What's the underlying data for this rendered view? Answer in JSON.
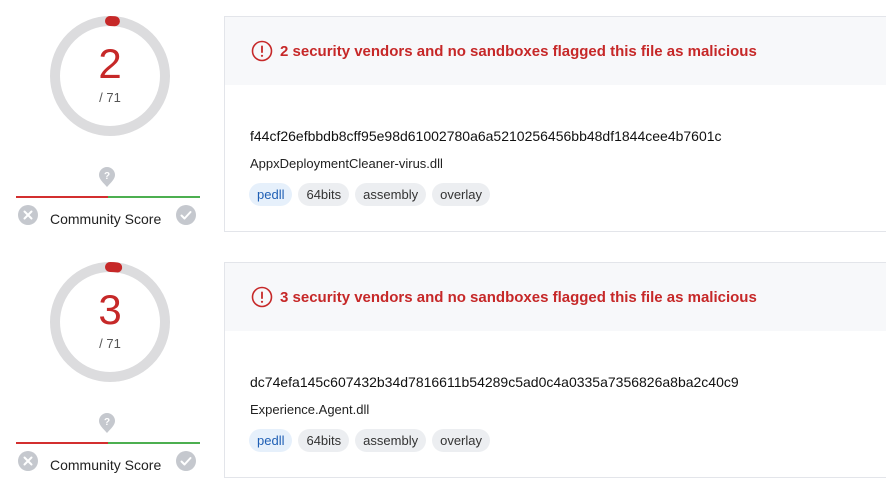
{
  "colors": {
    "alert": "#c62828",
    "gauge_track": "#dcdcde",
    "gauge_fill": "#c62828",
    "gauge_inner": "#ffffff",
    "score_negative": "#d32f2f",
    "score_positive": "#4caf50",
    "icon_gray": "#c5c8ce",
    "tag_primary_bg": "#e6f0fb",
    "tag_bg": "#eceef1"
  },
  "results": [
    {
      "detections": "2",
      "total": "/ 71",
      "detection_ratio": 0.028,
      "community_score_label": "Community Score",
      "alert": "2 security vendors and no sandboxes flagged this file as malicious",
      "hash": "f44cf26efbbdb8cff95e98d61002780a6a5210256456bb48df1844cee4b7601c",
      "filename": "AppxDeploymentCleaner-virus.dll",
      "tags": [
        "pedll",
        "64bits",
        "assembly",
        "overlay"
      ],
      "icons": {
        "unknown": "question-mark-icon",
        "negative": "x-icon",
        "positive": "check-icon",
        "alert": "exclamation-circle-icon"
      }
    },
    {
      "detections": "3",
      "total": "/ 71",
      "detection_ratio": 0.042,
      "community_score_label": "Community Score",
      "alert": "3 security vendors and no sandboxes flagged this file as malicious",
      "hash": "dc74efa145c607432b34d7816611b54289c5ad0c4a0335a7356826a8ba2c40c9",
      "filename": "Experience.Agent.dll",
      "tags": [
        "pedll",
        "64bits",
        "assembly",
        "overlay"
      ],
      "icons": {
        "unknown": "question-mark-icon",
        "negative": "x-icon",
        "positive": "check-icon",
        "alert": "exclamation-circle-icon"
      }
    }
  ]
}
